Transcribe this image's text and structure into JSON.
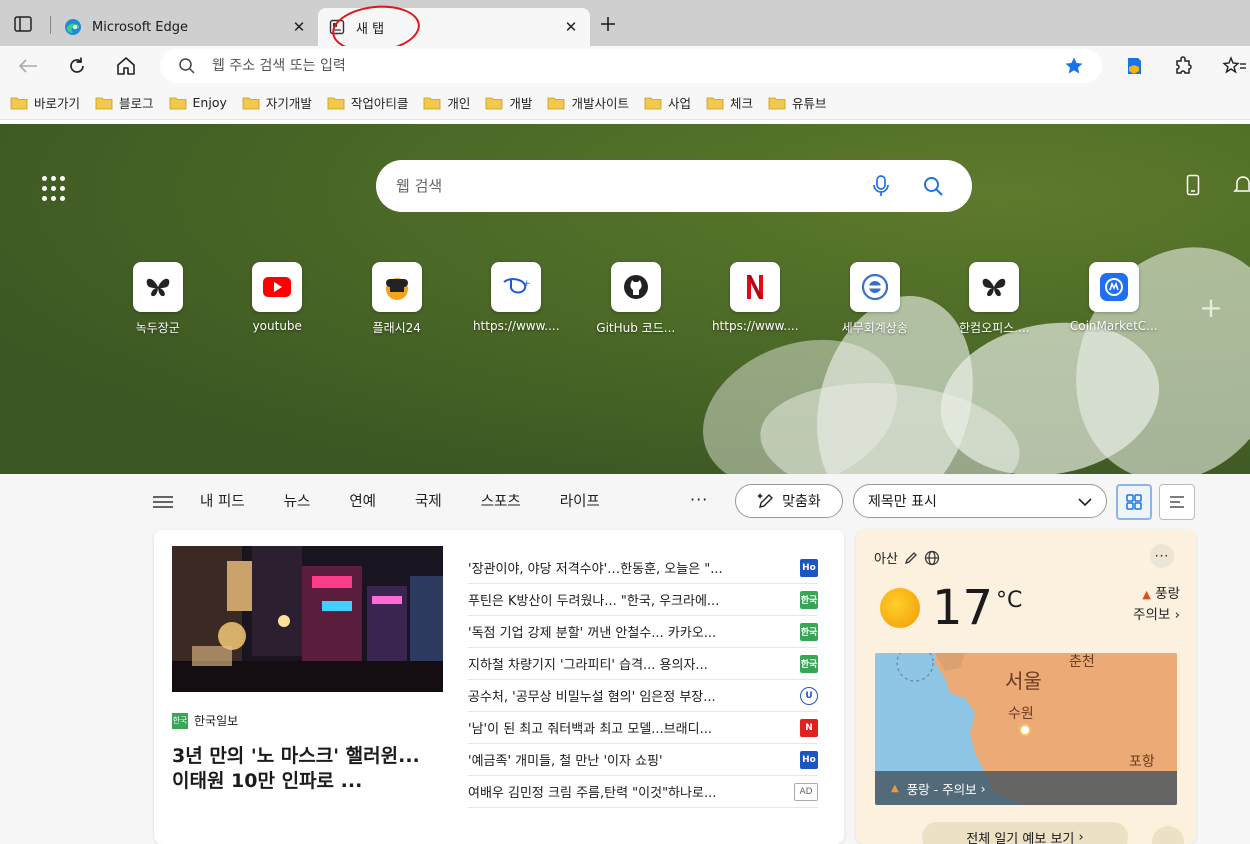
{
  "tabs": [
    {
      "title": "Microsoft Edge",
      "active": false
    },
    {
      "title": "새 탭",
      "active": true
    }
  ],
  "toolbar": {
    "address_placeholder": "웹 주소 검색 또는 입력"
  },
  "bookmarks": [
    "바로가기",
    "블로그",
    "Enjoy",
    "자기개발",
    "작업아티클",
    "개인",
    "개발",
    "개발사이트",
    "사업",
    "체크",
    "유튜브"
  ],
  "hero": {
    "search_placeholder": "웹 검색",
    "tiles": [
      {
        "label": "녹두장군",
        "icon": "butterfly-icon"
      },
      {
        "label": "youtube",
        "icon": "youtube-icon"
      },
      {
        "label": "플래시24",
        "icon": "flash24-icon"
      },
      {
        "label": "https://www....",
        "icon": "disney-plus-icon"
      },
      {
        "label": "GitHub 코드...",
        "icon": "github-icon"
      },
      {
        "label": "https://www....",
        "icon": "netflix-icon"
      },
      {
        "label": "세무회계상송",
        "icon": "tax-office-icon"
      },
      {
        "label": "한컴오피스 ...",
        "icon": "butterfly-icon"
      },
      {
        "label": "CoinMarketC...",
        "icon": "coinmarketcap-icon"
      }
    ]
  },
  "feed": {
    "tabs": [
      "내 피드",
      "뉴스",
      "연예",
      "국제",
      "스포츠",
      "라이프"
    ],
    "more": "···",
    "personalize": "맞춤화",
    "display_option": "제목만 표시"
  },
  "news": {
    "featured_source": "한국일보",
    "featured_headline": "3년 만의 '노 마스크' 핼러윈... 이태원 10만 인파로 ...",
    "list": [
      {
        "title": "'장관이야, 야당 저격수야'…한동훈, 오늘은 \"...",
        "badge": "blue",
        "badge_text": "Ho"
      },
      {
        "title": "푸틴은 K방산이 두려웠나... \"한국, 우크라에...",
        "badge": "green",
        "badge_text": "한국"
      },
      {
        "title": "'독점 기업 강제 분할' 꺼낸 안철수... 카카오...",
        "badge": "green",
        "badge_text": "한국"
      },
      {
        "title": "지하철 차량기지 '그라피티' 습격... 용의자...",
        "badge": "green",
        "badge_text": "한국"
      },
      {
        "title": "공수처, '공무상 비밀누설 혐의' 임은정 부장...",
        "badge": "navy",
        "badge_text": "U"
      },
      {
        "title": "'남'이 된 최고 줘터백과 최고 모델...브래디...",
        "badge": "red",
        "badge_text": "N"
      },
      {
        "title": "'예금족' 개미들, 철 만난 '이자 쇼핑'",
        "badge": "blue",
        "badge_text": "Ho"
      },
      {
        "title": "여배우 김민정 크림 주름,탄력 \"이것\"하나로...",
        "badge": "ad",
        "badge_text": "AD"
      }
    ]
  },
  "weather": {
    "location": "아산",
    "temperature": "17",
    "unit": "°C",
    "alert_line1": "풍랑",
    "alert_line2": "주의보",
    "map_cities": [
      "춘천",
      "서울",
      "수원",
      "포항"
    ],
    "map_alert": "풍랑 - 주의보",
    "forecast_button": "전체 일기 예보 보기"
  }
}
